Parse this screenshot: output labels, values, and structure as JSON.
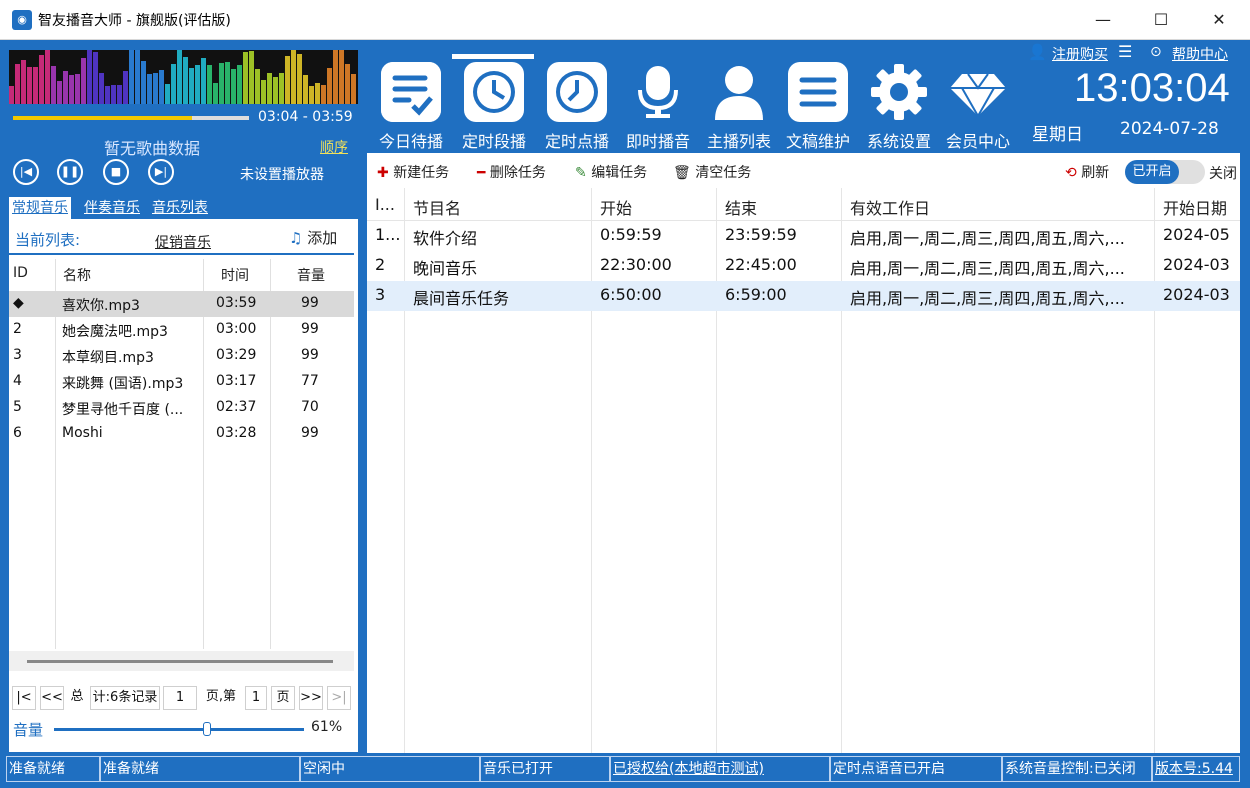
{
  "window": {
    "title": "智友播音大师 - 旗舰版(评估版)",
    "app_icon": "rss-broadcast-icon",
    "minimize": "—",
    "maximize": "☐",
    "close": "✕"
  },
  "player": {
    "time_range": "03:04 - 03:59",
    "progress": 0.76,
    "song_info": "暂无歌曲数据",
    "order_mode": "顺序",
    "player_status": "未设置播放器",
    "controls": [
      "previous-icon",
      "pause-icon",
      "stop-icon",
      "next-icon"
    ]
  },
  "left_tabs": [
    "常规音乐",
    "伴奏音乐",
    "音乐列表"
  ],
  "current_list": {
    "label": "当前列表:",
    "name": "促销音乐",
    "add_label": "添加"
  },
  "music_table": {
    "headers": [
      "ID",
      "名称",
      "时间",
      "音量"
    ],
    "rows": [
      {
        "id": "◆",
        "name": "喜欢你.mp3",
        "time": "03:59",
        "volume": "99"
      },
      {
        "id": "2",
        "name": "她会魔法吧.mp3",
        "time": "03:00",
        "volume": "99"
      },
      {
        "id": "3",
        "name": "本草纲目.mp3",
        "time": "03:29",
        "volume": "99"
      },
      {
        "id": "4",
        "name": "来跳舞 (国语).mp3",
        "time": "03:17",
        "volume": "77"
      },
      {
        "id": "5",
        "name": "梦里寻他千百度 (...",
        "time": "02:37",
        "volume": "70"
      },
      {
        "id": "6",
        "name": "Moshi",
        "time": "03:28",
        "volume": "99"
      }
    ]
  },
  "pagination": {
    "first": "|<",
    "prev": "<<",
    "total_prefix": "总",
    "total_text": "计:6条记录",
    "page_num": "1",
    "page_mid": "页,第",
    "page_cur": "1",
    "page_suffix": "页",
    "next": ">>",
    "last": ">|"
  },
  "volume": {
    "label": "音量",
    "value_text": "61%",
    "level": 0.61
  },
  "nav": {
    "items": [
      {
        "label": "今日待播",
        "icon": "checklist-icon"
      },
      {
        "label": "定时段播",
        "icon": "clock-range-icon"
      },
      {
        "label": "定时点播",
        "icon": "clock-point-icon"
      },
      {
        "label": "即时播音",
        "icon": "microphone-icon"
      },
      {
        "label": "主播列表",
        "icon": "user-icon"
      },
      {
        "label": "文稿维护",
        "icon": "document-icon"
      },
      {
        "label": "系统设置",
        "icon": "gear-icon"
      },
      {
        "label": "会员中心",
        "icon": "diamond-icon"
      }
    ],
    "active_index": 1,
    "register_link": "注册购买",
    "help_link": "帮助中心"
  },
  "clock": {
    "time": "13:03:04",
    "weekday": "星期日",
    "date": "2024-07-28"
  },
  "task_toolbar": {
    "new": "新建任务",
    "delete": "删除任务",
    "edit": "编辑任务",
    "clear": "清空任务",
    "refresh": "刷新",
    "toggle_on": "已开启",
    "toggle_off": "关闭"
  },
  "task_table": {
    "headers": [
      "I...",
      "节目名",
      "开始",
      "结束",
      "有效工作日",
      "开始日期"
    ],
    "rows": [
      {
        "id": "1...",
        "name": "软件介绍",
        "start": "0:59:59",
        "end": "23:59:59",
        "days": "启用,周一,周二,周三,周四,周五,周六,...",
        "start_date": "2024-05"
      },
      {
        "id": "2",
        "name": "晚间音乐",
        "start": "22:30:00",
        "end": "22:45:00",
        "days": "启用,周一,周二,周三,周四,周五,周六,...",
        "start_date": "2024-03"
      },
      {
        "id": "3",
        "name": "晨间音乐任务",
        "start": "6:50:00",
        "end": "6:59:00",
        "days": "启用,周一,周二,周三,周四,周五,周六,...",
        "start_date": "2024-03"
      }
    ],
    "selected_index": 2
  },
  "status_bar": [
    "准备就绪",
    "准备就绪",
    "空闲中",
    "音乐已打开",
    "已授权给(本地超市测试)",
    "定时点语音已开启",
    "系统音量控制:已关闭",
    "版本号:5.44"
  ]
}
